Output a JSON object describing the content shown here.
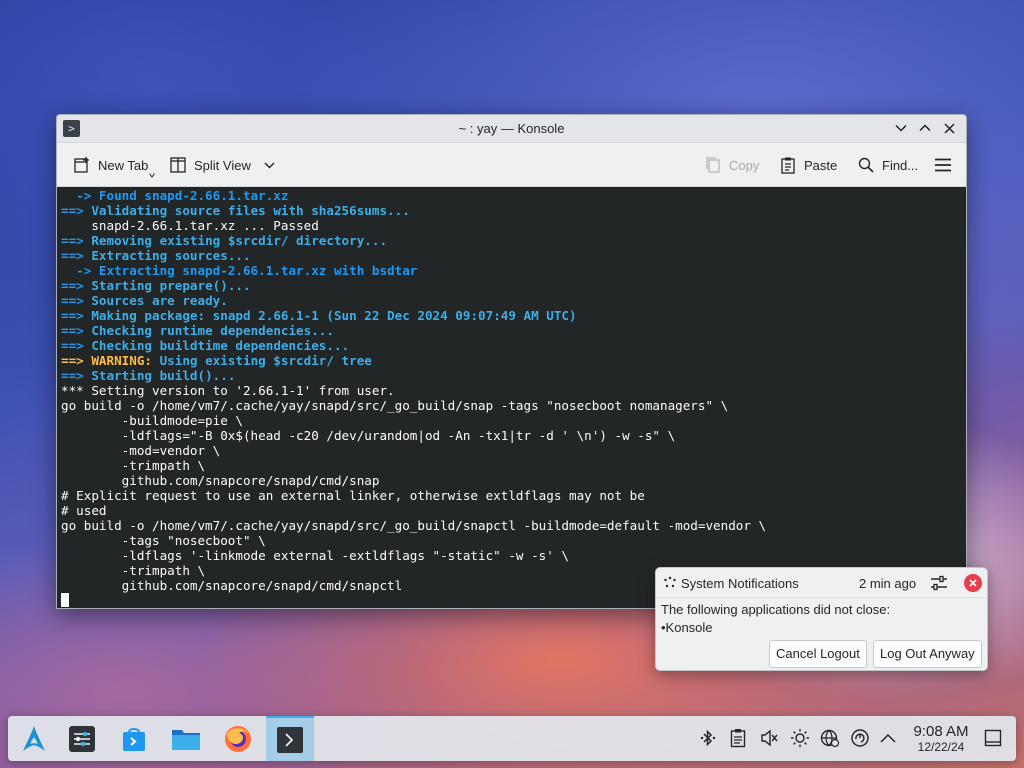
{
  "window": {
    "title": "~ : yay — Konsole",
    "toolbar": {
      "new_tab": "New Tab",
      "split_view": "Split View",
      "copy": "Copy",
      "paste": "Paste",
      "find": "Find..."
    }
  },
  "terminal": {
    "lines": [
      [
        {
          "t": "  -> Found snapd-2.66.1.tar.xz",
          "c": "blue"
        }
      ],
      [
        {
          "t": "==> ",
          "c": "blue"
        },
        {
          "t": "Validating source files with sha256sums...",
          "c": "bluetext"
        }
      ],
      [
        {
          "t": "    snapd-2.66.1.tar.xz ... Passed",
          "c": "plain"
        }
      ],
      [
        {
          "t": "==> ",
          "c": "blue"
        },
        {
          "t": "Removing existing $srcdir/ directory...",
          "c": "bluetext"
        }
      ],
      [
        {
          "t": "==> ",
          "c": "blue"
        },
        {
          "t": "Extracting sources...",
          "c": "bluetext"
        }
      ],
      [
        {
          "t": "  -> Extracting snapd-2.66.1.tar.xz with bsdtar",
          "c": "blue"
        }
      ],
      [
        {
          "t": "==> ",
          "c": "blue"
        },
        {
          "t": "Starting prepare()...",
          "c": "bluetext"
        }
      ],
      [
        {
          "t": "==> ",
          "c": "blue"
        },
        {
          "t": "Sources are ready.",
          "c": "bluetext"
        }
      ],
      [
        {
          "t": "==> ",
          "c": "blue"
        },
        {
          "t": "Making package: snapd 2.66.1-1 (Sun 22 Dec 2024 09:07:49 AM UTC)",
          "c": "bluetext"
        }
      ],
      [
        {
          "t": "==> ",
          "c": "blue"
        },
        {
          "t": "Checking runtime dependencies...",
          "c": "bluetext"
        }
      ],
      [
        {
          "t": "==> ",
          "c": "blue"
        },
        {
          "t": "Checking buildtime dependencies...",
          "c": "bluetext"
        }
      ],
      [
        {
          "t": "==> WARNING: ",
          "c": "yellow"
        },
        {
          "t": "Using existing $srcdir/ tree",
          "c": "bluetext"
        }
      ],
      [
        {
          "t": "==> ",
          "c": "blue"
        },
        {
          "t": "Starting build()...",
          "c": "bluetext"
        }
      ],
      [
        {
          "t": "*** Setting version to '2.66.1-1' from user.",
          "c": "plain"
        }
      ],
      [
        {
          "t": "go build -o /home/vm7/.cache/yay/snapd/src/_go_build/snap -tags \"nosecboot nomanagers\" \\",
          "c": "plain"
        }
      ],
      [
        {
          "t": "        -buildmode=pie \\",
          "c": "plain"
        }
      ],
      [
        {
          "t": "        -ldflags=\"-B 0x$(head -c20 /dev/urandom|od -An -tx1|tr -d ' \\n') -w -s\" \\",
          "c": "plain"
        }
      ],
      [
        {
          "t": "        -mod=vendor \\",
          "c": "plain"
        }
      ],
      [
        {
          "t": "        -trimpath \\",
          "c": "plain"
        }
      ],
      [
        {
          "t": "        github.com/snapcore/snapd/cmd/snap",
          "c": "plain"
        }
      ],
      [
        {
          "t": "# Explicit request to use an external linker, otherwise extldflags may not be",
          "c": "plain"
        }
      ],
      [
        {
          "t": "# used",
          "c": "plain"
        }
      ],
      [
        {
          "t": "go build -o /home/vm7/.cache/yay/snapd/src/_go_build/snapctl -buildmode=default -mod=vendor \\",
          "c": "plain"
        }
      ],
      [
        {
          "t": "        -tags \"nosecboot\" \\",
          "c": "plain"
        }
      ],
      [
        {
          "t": "        -ldflags '-linkmode external -extldflags \"-static\" -w -s' \\",
          "c": "plain"
        }
      ],
      [
        {
          "t": "        -trimpath \\",
          "c": "plain"
        }
      ],
      [
        {
          "t": "        github.com/snapcore/snapd/cmd/snapctl",
          "c": "plain"
        }
      ]
    ]
  },
  "notification": {
    "app_name": "System Notifications",
    "time": "2 min ago",
    "message": "The following applications did not close:",
    "item": "•Konsole",
    "cancel_label": "Cancel Logout",
    "logout_label": "Log Out Anyway"
  },
  "taskbar": {
    "launchers": [
      "application-launcher-icon",
      "system-settings-icon",
      "discover-icon",
      "file-manager-icon",
      "firefox-icon",
      "konsole-icon"
    ],
    "tray": [
      "bluetooth-icon",
      "clipboard-icon",
      "volume-muted-icon",
      "brightness-icon",
      "network-icon",
      "update-icon",
      "show-hidden-icon"
    ],
    "clock_time": "9:08 AM",
    "clock_date": "12/22/24"
  },
  "colors": {
    "accent": "#3daee9",
    "terminal_bg": "#232627",
    "terminal_blue": "#1d99f3",
    "terminal_warning": "#fdbc4b",
    "close_red": "#e83d4c"
  }
}
